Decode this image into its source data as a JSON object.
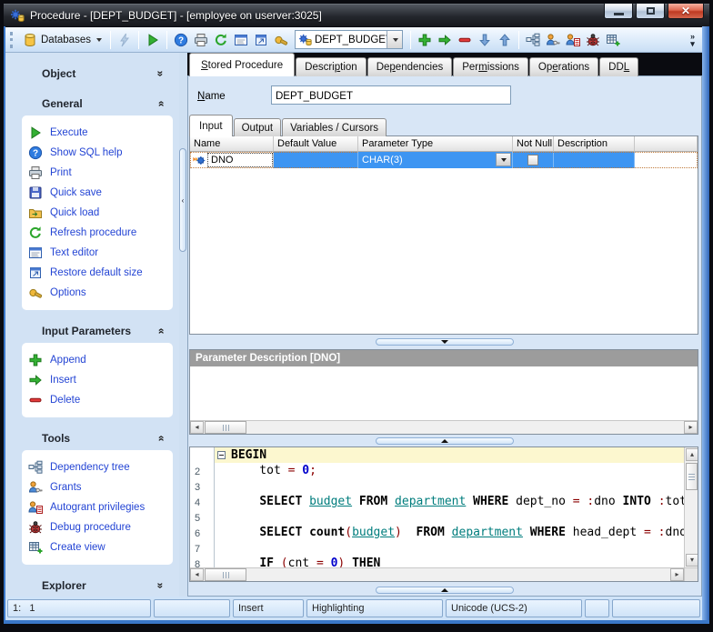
{
  "window": {
    "title": "Procedure - [DEPT_BUDGET] - [employee on userver:3025]",
    "icon": "procedure",
    "buttons": [
      "minimize",
      "maximize",
      "close"
    ]
  },
  "colors": {
    "selection_blue": "#3d95f2",
    "frame_blue": "#3a77c8",
    "link_blue": "#2344d4",
    "current_line": "#fcf7cf",
    "symbol": "#8b0000",
    "number": "#0000cc",
    "table_object": "#007d7d",
    "param_desc_header_bg": "#9c9c9c"
  },
  "toolbar": {
    "groups": [
      {
        "type": "grip",
        "name": "toolbar-grip"
      },
      {
        "type": "button",
        "name": "databases-button",
        "icon": "database",
        "label": "Databases",
        "caret": true
      },
      {
        "type": "sep"
      },
      {
        "type": "icon",
        "name": "compile-button",
        "icon": "bolt",
        "disabled": true
      },
      {
        "type": "sep"
      },
      {
        "type": "icon",
        "name": "execute-button",
        "icon": "play"
      },
      {
        "type": "sep"
      },
      {
        "type": "icon",
        "name": "help-button",
        "icon": "help"
      },
      {
        "type": "icon",
        "name": "print-button",
        "icon": "printer"
      },
      {
        "type": "icon",
        "name": "refresh-button",
        "icon": "refresh"
      },
      {
        "type": "icon",
        "name": "text-editor-button",
        "icon": "texteditor"
      },
      {
        "type": "icon",
        "name": "restore-default-size-button",
        "icon": "restoresize"
      },
      {
        "type": "icon",
        "name": "options-button",
        "icon": "options"
      },
      {
        "type": "combo",
        "name": "procedure-combo",
        "icon": "procedure",
        "value": "DEPT_BUDGET"
      },
      {
        "type": "sep"
      },
      {
        "type": "icon",
        "name": "append-button",
        "icon": "plus"
      },
      {
        "type": "icon",
        "name": "insert-button",
        "icon": "arrowright"
      },
      {
        "type": "icon",
        "name": "delete-button",
        "icon": "minus"
      },
      {
        "type": "icon",
        "name": "move-down-button",
        "icon": "arrowdown"
      },
      {
        "type": "icon",
        "name": "move-up-button",
        "icon": "arrowup"
      },
      {
        "type": "sep"
      },
      {
        "type": "icon",
        "name": "dependency-tree-button",
        "icon": "deptree"
      },
      {
        "type": "icon",
        "name": "grants-button",
        "icon": "grants"
      },
      {
        "type": "icon",
        "name": "autogrant-button",
        "icon": "autogrant"
      },
      {
        "type": "icon",
        "name": "debug-button",
        "icon": "bug"
      },
      {
        "type": "icon",
        "name": "create-view-button",
        "icon": "createview"
      },
      {
        "type": "overflow",
        "name": "toolbar-overflow-button"
      }
    ]
  },
  "sidebar": {
    "sections": [
      {
        "title": "Object",
        "state": "collapsed",
        "items": []
      },
      {
        "title": "General",
        "state": "expanded",
        "items": [
          {
            "icon": "play",
            "label": "Execute"
          },
          {
            "icon": "help",
            "label": "Show SQL help"
          },
          {
            "icon": "printer",
            "label": "Print"
          },
          {
            "icon": "saveq",
            "label": "Quick save"
          },
          {
            "icon": "loadq",
            "label": "Quick load"
          },
          {
            "icon": "refresh",
            "label": "Refresh procedure"
          },
          {
            "icon": "texteditor",
            "label": "Text editor"
          },
          {
            "icon": "restoresize",
            "label": "Restore default size"
          },
          {
            "icon": "options",
            "label": "Options"
          }
        ]
      },
      {
        "title": "Input Parameters",
        "state": "expanded",
        "items": [
          {
            "icon": "plus",
            "label": "Append"
          },
          {
            "icon": "arrowright",
            "label": "Insert"
          },
          {
            "icon": "minus",
            "label": "Delete"
          }
        ]
      },
      {
        "title": "Tools",
        "state": "expanded",
        "items": [
          {
            "icon": "deptree",
            "label": "Dependency tree"
          },
          {
            "icon": "grants",
            "label": "Grants"
          },
          {
            "icon": "autogrant",
            "label": "Autogrant privilegies"
          },
          {
            "icon": "bug",
            "label": "Debug procedure"
          },
          {
            "icon": "createview",
            "label": "Create view"
          }
        ]
      },
      {
        "title": "Explorer",
        "state": "collapsed",
        "items": []
      }
    ]
  },
  "main": {
    "tabs": [
      {
        "label": "Stored Procedure",
        "u": 0,
        "active": true
      },
      {
        "label": "Description",
        "u": 6
      },
      {
        "label": "Dependencies",
        "u": 2
      },
      {
        "label": "Permissions",
        "u": 3
      },
      {
        "label": "Operations",
        "u": 2
      },
      {
        "label": "DDL",
        "u": 2
      }
    ],
    "name_label": "Name",
    "name_value": "DEPT_BUDGET",
    "param_tabs": [
      {
        "label": "Input",
        "active": true
      },
      {
        "label": "Output"
      },
      {
        "label": "Variables / Cursors"
      }
    ],
    "grid": {
      "columns": [
        "Name",
        "Default Value",
        "Parameter Type",
        "Not Null",
        "Description"
      ],
      "rows": [
        {
          "icon": "paramrow",
          "name": "DNO",
          "default_value": "",
          "parameter_type": "CHAR(3)",
          "not_null": false,
          "description": ""
        }
      ]
    },
    "param_description": {
      "header": "Parameter Description [DNO]"
    },
    "editor": {
      "lines": [
        {
          "num": "",
          "fold": true,
          "current": true,
          "tokens": [
            [
              "BEGIN",
              "kw"
            ]
          ]
        },
        {
          "num": "2",
          "tokens": [
            [
              "    tot ",
              "id"
            ],
            [
              "=",
              "sym"
            ],
            [
              " ",
              "id"
            ],
            [
              "0",
              "num"
            ],
            [
              ";",
              "sym"
            ]
          ]
        },
        {
          "num": "3",
          "tokens": []
        },
        {
          "num": "4",
          "tokens": [
            [
              "    ",
              "id"
            ],
            [
              "SELECT",
              "kw"
            ],
            [
              " ",
              "id"
            ],
            [
              "budget",
              "obj"
            ],
            [
              " ",
              "id"
            ],
            [
              "FROM",
              "kw"
            ],
            [
              " ",
              "id"
            ],
            [
              "department",
              "obj"
            ],
            [
              " ",
              "id"
            ],
            [
              "WHERE",
              "kw"
            ],
            [
              " dept_no ",
              "id"
            ],
            [
              "=",
              "sym"
            ],
            [
              " ",
              "id"
            ],
            [
              ":",
              "sym"
            ],
            [
              "dno ",
              "id"
            ],
            [
              "INTO",
              "kw"
            ],
            [
              " ",
              "id"
            ],
            [
              ":",
              "sym"
            ],
            [
              "tot",
              "id"
            ]
          ]
        },
        {
          "num": "5",
          "tokens": []
        },
        {
          "num": "6",
          "tokens": [
            [
              "    ",
              "id"
            ],
            [
              "SELECT",
              "kw"
            ],
            [
              " ",
              "id"
            ],
            [
              "count",
              "kw"
            ],
            [
              "(",
              "sym"
            ],
            [
              "budget",
              "obj"
            ],
            [
              ")",
              "sym"
            ],
            [
              "  ",
              "id"
            ],
            [
              "FROM",
              "kw"
            ],
            [
              " ",
              "id"
            ],
            [
              "department",
              "obj"
            ],
            [
              " ",
              "id"
            ],
            [
              "WHERE",
              "kw"
            ],
            [
              " head_dept ",
              "id"
            ],
            [
              "=",
              "sym"
            ],
            [
              " ",
              "id"
            ],
            [
              ":",
              "sym"
            ],
            [
              "dno",
              "id"
            ]
          ]
        },
        {
          "num": "7",
          "tokens": []
        },
        {
          "num": "8",
          "tokens": [
            [
              "    ",
              "id"
            ],
            [
              "IF",
              "kw"
            ],
            [
              " ",
              "id"
            ],
            [
              "(",
              "sym"
            ],
            [
              "cnt ",
              "id"
            ],
            [
              "=",
              "sym"
            ],
            [
              " ",
              "id"
            ],
            [
              "0",
              "num"
            ],
            [
              ")",
              "sym"
            ],
            [
              " ",
              "id"
            ],
            [
              "THEN",
              "kw"
            ]
          ]
        }
      ]
    }
  },
  "statusbar": {
    "cells": [
      "1:   1",
      "",
      "Insert",
      "Highlighting",
      "Unicode (UCS-2)",
      "",
      ""
    ]
  }
}
